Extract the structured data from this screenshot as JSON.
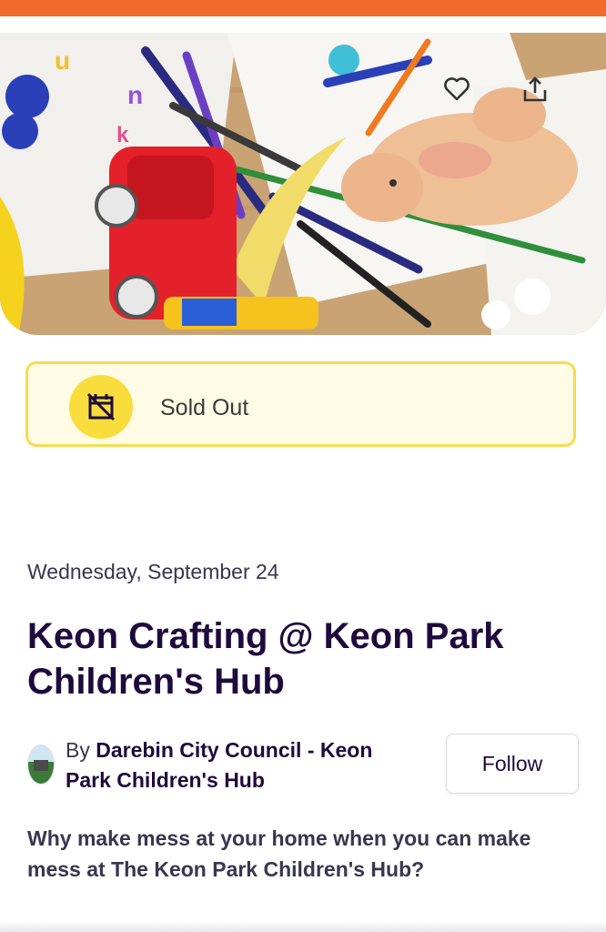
{
  "colors": {
    "brand_bar": "#f26b2b",
    "status_border": "#f5dc52",
    "status_icon_bg": "#f8dd3c",
    "title": "#1e0a3c"
  },
  "hero": {
    "like_icon": "heart-outline-icon",
    "share_icon": "share-upload-icon"
  },
  "status": {
    "icon": "calendar-cancel-icon",
    "label": "Sold Out"
  },
  "event": {
    "date": "Wednesday, September 24",
    "title": "Keon Crafting @ Keon Park Children's Hub",
    "organizer_prefix": "By",
    "organizer_name": "Darebin City Council - Keon Park Children's Hub",
    "follow_label": "Follow",
    "summary": "Why make mess at your home when you can make mess at The Keon Park Children's Hub?"
  }
}
